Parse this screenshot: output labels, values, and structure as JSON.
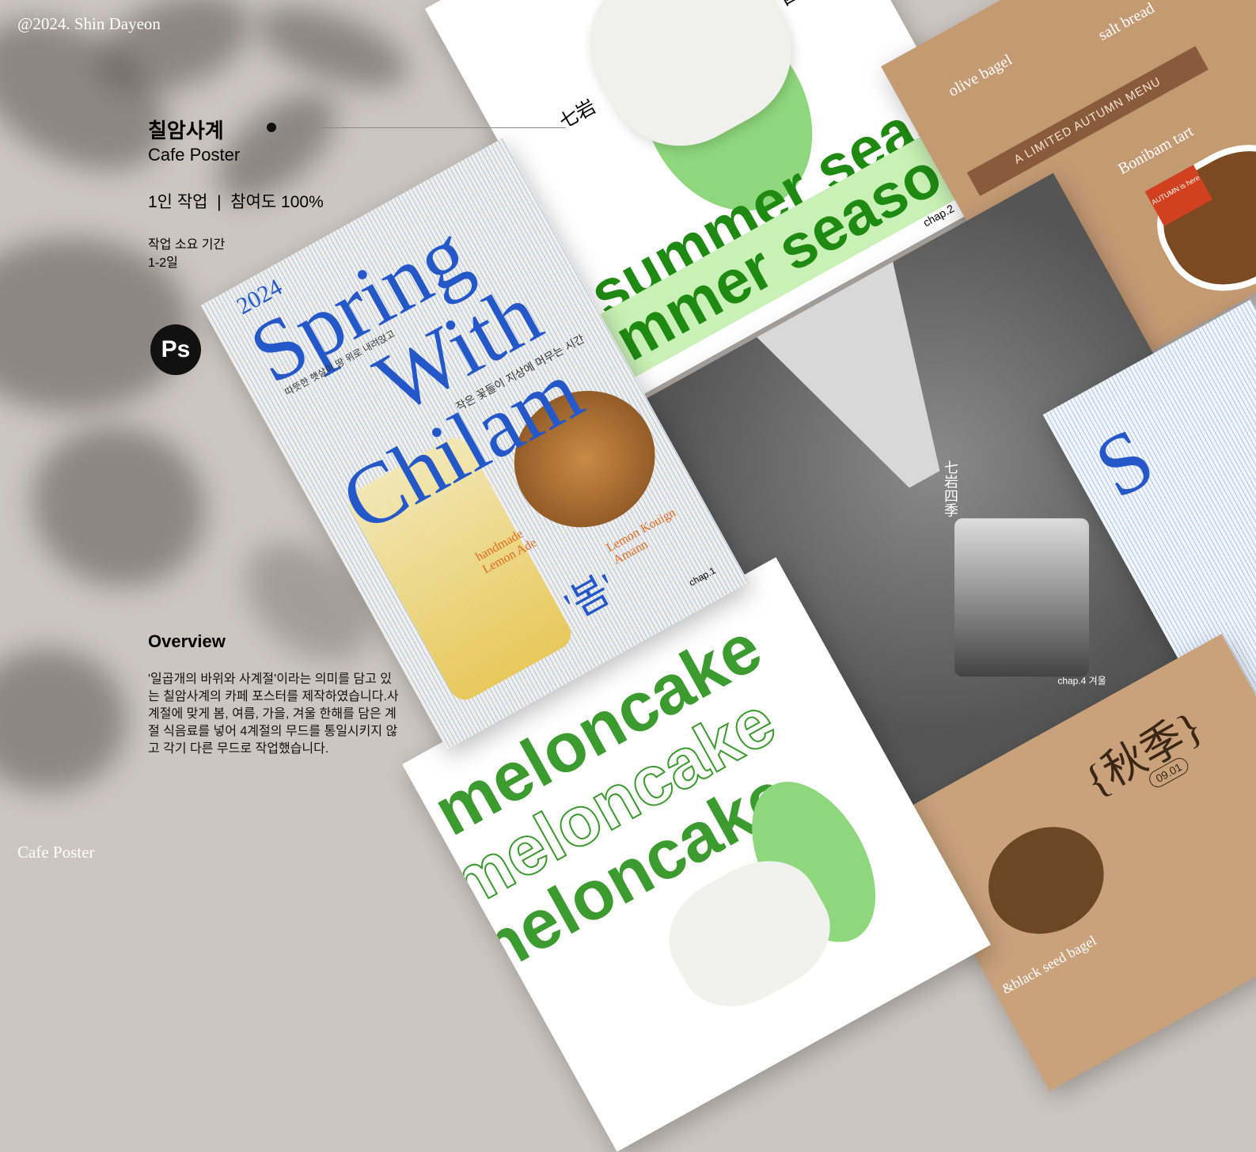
{
  "copyright": "@2024. Shin Dayeon",
  "footer_label": "Cafe Poster",
  "project": {
    "title": "칠암사계",
    "subtitle": "Cafe Poster",
    "meta": "1인 작업  |  참여도 100%",
    "duration_label": "작업 소요 기간",
    "duration_value": "1-2일",
    "tool_badge": "Ps"
  },
  "overview": {
    "heading": "Overview",
    "lines": [
      "'일곱개의 바위와 사계절'이라는 의미를 담고 있",
      "는 칠암사계의 카페 포스터를 제작하였습니다.사",
      "계절에 맞게 봄, 여름, 가을, 겨울 한해를 담은 계",
      "절 식음료를 넣어 4계절의 무드를 통일시키지 않",
      "고 각기 다른 무드로 작업했습니다."
    ]
  },
  "posters": {
    "spring": {
      "year": "2024",
      "line1": "Spring",
      "line2": "With",
      "line3": "Chilam",
      "korean1": "따뜻한 햇살이 땅 위로 내려앉고",
      "korean2": "작은 꽃들이 지상에 머무는 시간",
      "item1": "handmade Lemon Ade",
      "item2": "Lemon Kouign Amann",
      "season": "'봄'",
      "chap": "chap.1"
    },
    "summer": {
      "hanja_left": "七岩",
      "hanja_right": "四季",
      "text": "summer season",
      "chap": "chap.2"
    },
    "melon": {
      "text": "meloncake"
    },
    "winter": {
      "hanja": "七岩四季",
      "chap": "chap.4 겨울"
    },
    "autumn": {
      "banner": "A LIMITED AUTUMN MENU",
      "item1": "olive bagel",
      "item2": "salt bread",
      "item3": "Bonibam tart",
      "tag": "AUTUMN is here",
      "item4": "&black seed bagel",
      "hanja": "{秋季}",
      "date": "09.01"
    }
  }
}
